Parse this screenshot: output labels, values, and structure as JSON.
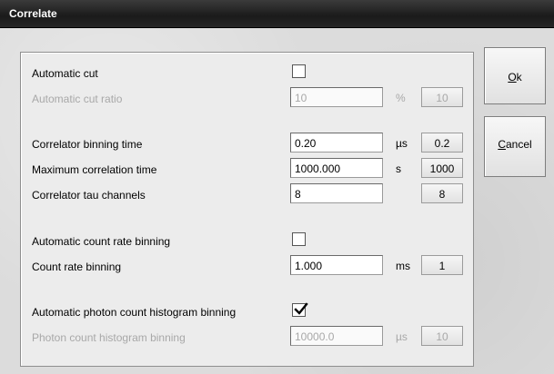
{
  "window": {
    "title": "Correlate"
  },
  "buttons": {
    "ok_prefix": "O",
    "ok_rest": "k",
    "cancel_prefix": "C",
    "cancel_rest": "ancel"
  },
  "rows": {
    "auto_cut": {
      "label": "Automatic cut",
      "checked": false
    },
    "auto_cut_ratio": {
      "label": "Automatic cut ratio",
      "value": "10",
      "unit": "%",
      "button": "10",
      "disabled": true
    },
    "binning_time": {
      "label": "Correlator binning time",
      "value": "0.20",
      "unit": "µs",
      "button": "0.2"
    },
    "max_corr_time": {
      "label": "Maximum correlation time",
      "value": "1000.000",
      "unit": "s",
      "button": "1000"
    },
    "tau_channels": {
      "label": "Correlator tau channels",
      "value": "8",
      "unit": "",
      "button": "8"
    },
    "auto_rate_binning": {
      "label": "Automatic count rate binning",
      "checked": false
    },
    "rate_binning": {
      "label": "Count rate binning",
      "value": "1.000",
      "unit": "ms",
      "button": "1"
    },
    "auto_photon_hist": {
      "label": "Automatic photon count histogram binning",
      "checked": true
    },
    "photon_hist_binning": {
      "label": "Photon count histogram binning",
      "value": "10000.0",
      "unit": "µs",
      "button": "10",
      "disabled": true
    }
  },
  "icons": {
    "checkmark": "checkmark-icon"
  }
}
